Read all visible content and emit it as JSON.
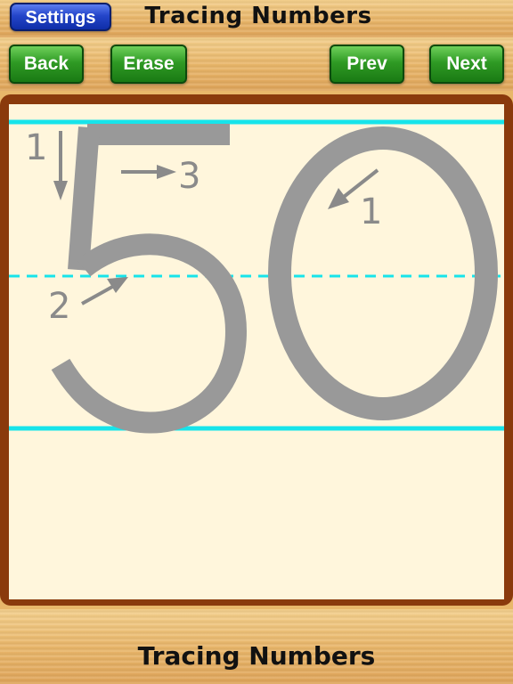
{
  "header": {
    "title": "Tracing Numbers",
    "settings_label": "Settings"
  },
  "toolbar": {
    "back_label": "Back",
    "erase_label": "Erase",
    "prev_label": "Prev",
    "next_label": "Next"
  },
  "board": {
    "number": "50",
    "stroke_labels": {
      "five_step1": "1",
      "five_step2": "2",
      "five_step3": "3",
      "zero_step1": "1"
    }
  },
  "footer": {
    "title": "Tracing Numbers"
  },
  "colors": {
    "guide_line": "#17e4ea",
    "digit": "#999999",
    "paper": "#fff6dc",
    "frame": "#8a3a0c"
  }
}
